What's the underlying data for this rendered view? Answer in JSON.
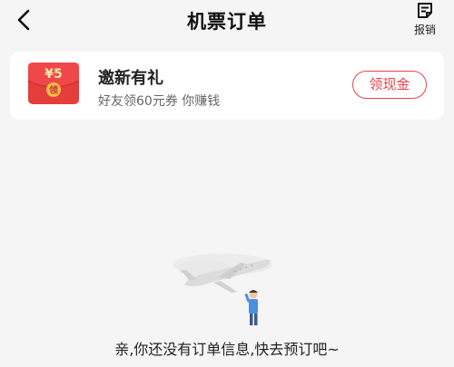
{
  "header": {
    "title": "机票订单",
    "reimburse_label": "报销"
  },
  "promo": {
    "envelope_amount": "¥5",
    "envelope_label": "领",
    "title": "邀新有礼",
    "subtitle": "好友领60元券 你赚钱",
    "button_label": "领现金"
  },
  "empty_state": {
    "message": "亲,你还没有订单信息,快去预订吧~"
  },
  "colors": {
    "accent": "#e8434a",
    "background": "#f5f5f5",
    "card": "#ffffff",
    "envelope_red": "#e53c3c",
    "envelope_gold": "#f6c244"
  },
  "icons": {
    "back": "chevron-left-icon",
    "reimburse": "receipt-icon",
    "envelope": "red-envelope-icon",
    "empty": "airplane-illustration"
  }
}
